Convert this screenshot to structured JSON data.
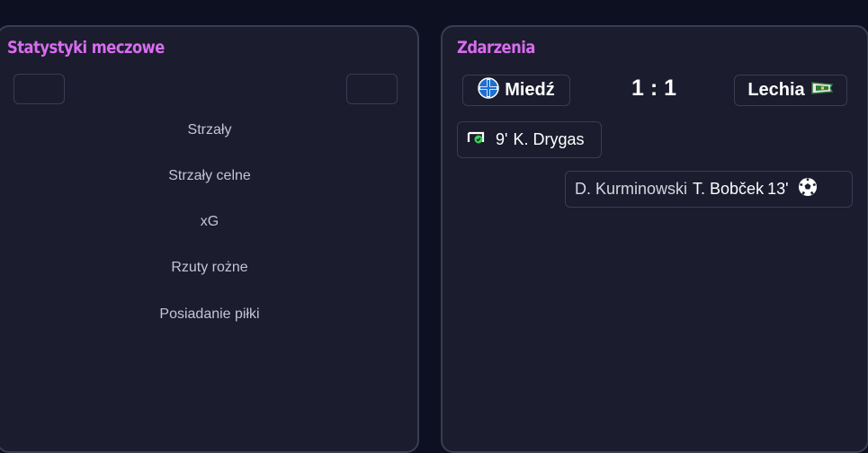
{
  "stats": {
    "title": "Statystyki meczowe",
    "rows": [
      "Strzały",
      "Strzały celne",
      "xG",
      "Rzuty rożne",
      "Posiadanie piłki"
    ]
  },
  "events": {
    "title": "Zdarzenia",
    "home_team": "Miedź",
    "away_team": "Lechia",
    "score": "1 : 1",
    "items": [
      {
        "minute": "9'",
        "player": "K. Drygas",
        "icon": "penalty-goal-icon"
      },
      {
        "assist": "D. Kurminowski",
        "player": "T. Bobček",
        "minute": "13'",
        "icon": "soccer-ball-icon"
      }
    ]
  },
  "colors": {
    "background": "#0c1020",
    "panel": "#1b1c2d",
    "border": "#3a3c52",
    "title_accent": "#d86cf0",
    "goal_green": "#3bd15a"
  }
}
